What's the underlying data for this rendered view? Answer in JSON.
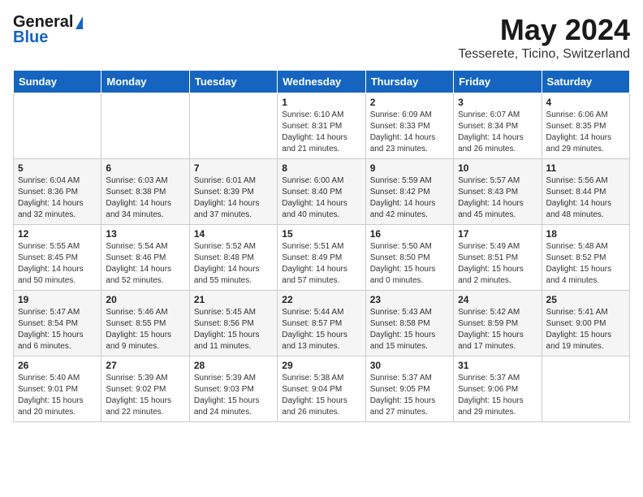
{
  "logo": {
    "general": "General",
    "blue": "Blue"
  },
  "title": "May 2024",
  "location": "Tesserete, Ticino, Switzerland",
  "days_of_week": [
    "Sunday",
    "Monday",
    "Tuesday",
    "Wednesday",
    "Thursday",
    "Friday",
    "Saturday"
  ],
  "weeks": [
    [
      {
        "day": "",
        "info": ""
      },
      {
        "day": "",
        "info": ""
      },
      {
        "day": "",
        "info": ""
      },
      {
        "day": "1",
        "info": "Sunrise: 6:10 AM\nSunset: 8:31 PM\nDaylight: 14 hours\nand 21 minutes."
      },
      {
        "day": "2",
        "info": "Sunrise: 6:09 AM\nSunset: 8:33 PM\nDaylight: 14 hours\nand 23 minutes."
      },
      {
        "day": "3",
        "info": "Sunrise: 6:07 AM\nSunset: 8:34 PM\nDaylight: 14 hours\nand 26 minutes."
      },
      {
        "day": "4",
        "info": "Sunrise: 6:06 AM\nSunset: 8:35 PM\nDaylight: 14 hours\nand 29 minutes."
      }
    ],
    [
      {
        "day": "5",
        "info": "Sunrise: 6:04 AM\nSunset: 8:36 PM\nDaylight: 14 hours\nand 32 minutes."
      },
      {
        "day": "6",
        "info": "Sunrise: 6:03 AM\nSunset: 8:38 PM\nDaylight: 14 hours\nand 34 minutes."
      },
      {
        "day": "7",
        "info": "Sunrise: 6:01 AM\nSunset: 8:39 PM\nDaylight: 14 hours\nand 37 minutes."
      },
      {
        "day": "8",
        "info": "Sunrise: 6:00 AM\nSunset: 8:40 PM\nDaylight: 14 hours\nand 40 minutes."
      },
      {
        "day": "9",
        "info": "Sunrise: 5:59 AM\nSunset: 8:42 PM\nDaylight: 14 hours\nand 42 minutes."
      },
      {
        "day": "10",
        "info": "Sunrise: 5:57 AM\nSunset: 8:43 PM\nDaylight: 14 hours\nand 45 minutes."
      },
      {
        "day": "11",
        "info": "Sunrise: 5:56 AM\nSunset: 8:44 PM\nDaylight: 14 hours\nand 48 minutes."
      }
    ],
    [
      {
        "day": "12",
        "info": "Sunrise: 5:55 AM\nSunset: 8:45 PM\nDaylight: 14 hours\nand 50 minutes."
      },
      {
        "day": "13",
        "info": "Sunrise: 5:54 AM\nSunset: 8:46 PM\nDaylight: 14 hours\nand 52 minutes."
      },
      {
        "day": "14",
        "info": "Sunrise: 5:52 AM\nSunset: 8:48 PM\nDaylight: 14 hours\nand 55 minutes."
      },
      {
        "day": "15",
        "info": "Sunrise: 5:51 AM\nSunset: 8:49 PM\nDaylight: 14 hours\nand 57 minutes."
      },
      {
        "day": "16",
        "info": "Sunrise: 5:50 AM\nSunset: 8:50 PM\nDaylight: 15 hours\nand 0 minutes."
      },
      {
        "day": "17",
        "info": "Sunrise: 5:49 AM\nSunset: 8:51 PM\nDaylight: 15 hours\nand 2 minutes."
      },
      {
        "day": "18",
        "info": "Sunrise: 5:48 AM\nSunset: 8:52 PM\nDaylight: 15 hours\nand 4 minutes."
      }
    ],
    [
      {
        "day": "19",
        "info": "Sunrise: 5:47 AM\nSunset: 8:54 PM\nDaylight: 15 hours\nand 6 minutes."
      },
      {
        "day": "20",
        "info": "Sunrise: 5:46 AM\nSunset: 8:55 PM\nDaylight: 15 hours\nand 9 minutes."
      },
      {
        "day": "21",
        "info": "Sunrise: 5:45 AM\nSunset: 8:56 PM\nDaylight: 15 hours\nand 11 minutes."
      },
      {
        "day": "22",
        "info": "Sunrise: 5:44 AM\nSunset: 8:57 PM\nDaylight: 15 hours\nand 13 minutes."
      },
      {
        "day": "23",
        "info": "Sunrise: 5:43 AM\nSunset: 8:58 PM\nDaylight: 15 hours\nand 15 minutes."
      },
      {
        "day": "24",
        "info": "Sunrise: 5:42 AM\nSunset: 8:59 PM\nDaylight: 15 hours\nand 17 minutes."
      },
      {
        "day": "25",
        "info": "Sunrise: 5:41 AM\nSunset: 9:00 PM\nDaylight: 15 hours\nand 19 minutes."
      }
    ],
    [
      {
        "day": "26",
        "info": "Sunrise: 5:40 AM\nSunset: 9:01 PM\nDaylight: 15 hours\nand 20 minutes."
      },
      {
        "day": "27",
        "info": "Sunrise: 5:39 AM\nSunset: 9:02 PM\nDaylight: 15 hours\nand 22 minutes."
      },
      {
        "day": "28",
        "info": "Sunrise: 5:39 AM\nSunset: 9:03 PM\nDaylight: 15 hours\nand 24 minutes."
      },
      {
        "day": "29",
        "info": "Sunrise: 5:38 AM\nSunset: 9:04 PM\nDaylight: 15 hours\nand 26 minutes."
      },
      {
        "day": "30",
        "info": "Sunrise: 5:37 AM\nSunset: 9:05 PM\nDaylight: 15 hours\nand 27 minutes."
      },
      {
        "day": "31",
        "info": "Sunrise: 5:37 AM\nSunset: 9:06 PM\nDaylight: 15 hours\nand 29 minutes."
      },
      {
        "day": "",
        "info": ""
      }
    ]
  ]
}
